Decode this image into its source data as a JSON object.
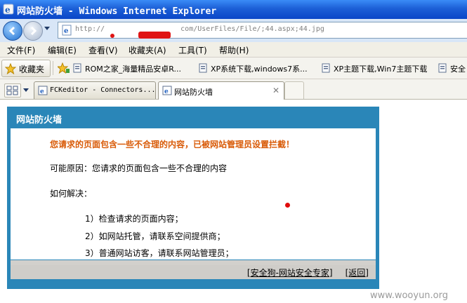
{
  "window": {
    "title": "网站防火墙 - Windows Internet Explorer",
    "app_icon": "ie-icon",
    "title_color": "#1c5fd6"
  },
  "address_bar": {
    "url_prefix": "http://",
    "url_suffix": "com/UserFiles/File/;44.aspx;44.jpg",
    "back_icon": "back-arrow-icon",
    "forward_icon": "forward-arrow-icon"
  },
  "menu": {
    "items": [
      "文件(F)",
      "编辑(E)",
      "查看(V)",
      "收藏夹(A)",
      "工具(T)",
      "帮助(H)"
    ]
  },
  "favorites_bar": {
    "favorites_label": "收藏夹",
    "links": [
      "ROM之家_海量精品安卓R...",
      "XP系统下载,windows7系...",
      "XP主题下载,Win7主题下载",
      "安全"
    ]
  },
  "tabs": [
    {
      "label": "FCKeditor - Connectors...",
      "active": false
    },
    {
      "label": "网站防火墙",
      "active": true
    }
  ],
  "firewall": {
    "header_title": "网站防火墙",
    "warning": "您请求的页面包含一些不合理的内容，已被网站管理员设置拦截！",
    "reason": "可能原因：您请求的页面包含一些不合理的内容",
    "howto": "如何解决：",
    "steps": [
      "1）检查请求的页面内容；",
      "2）如网站托管，请联系空间提供商；",
      "3）普通网站访客，请联系网站管理员；"
    ],
    "footer_links": [
      "[安全狗-网站安全专家]",
      "[返回]"
    ],
    "accent_color": "#2a86b8",
    "warning_color": "#d95b08"
  },
  "watermark": "www.wooyun.org"
}
